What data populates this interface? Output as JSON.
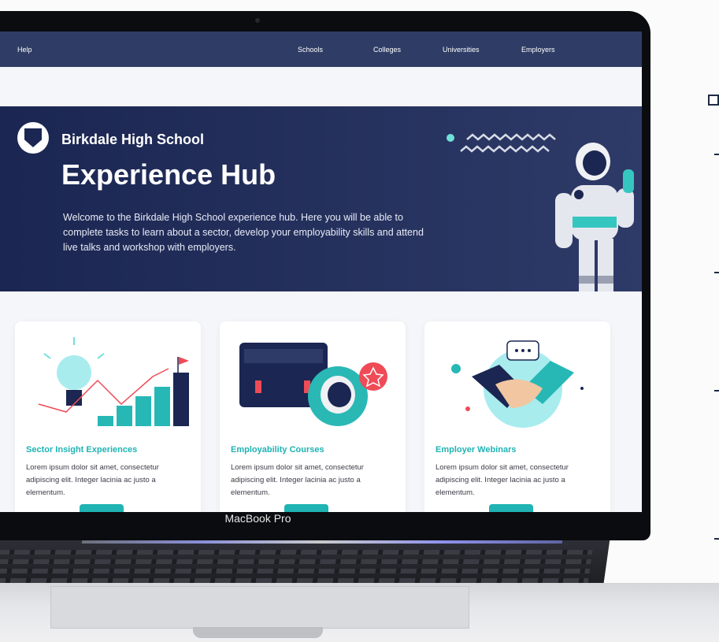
{
  "nav": {
    "help": "Help",
    "links": [
      "Schools",
      "Colleges",
      "Universities",
      "Employers"
    ]
  },
  "hero": {
    "school_name": "Birkdale High School",
    "title": "Experience Hub",
    "intro": "Welcome to the Birkdale High School experience hub. Here you will be able to complete tasks to learn about a sector, develop your employability skills and attend live talks and workshop with employers."
  },
  "cards": [
    {
      "title": "Sector Insight Experiences",
      "description": "Lorem ipsum dolor sit amet, consectetur adipiscing elit. Integer lacinia ac justo a elementum.",
      "icon": "lightbulb-growth-chart-icon"
    },
    {
      "title": "Employability Courses",
      "description": "Lorem ipsum dolor sit amet, consectetur adipiscing elit. Integer lacinia ac justo a elementum.",
      "icon": "briefcase-astronaut-icon"
    },
    {
      "title": "Employer  Webinars",
      "description": "Lorem ipsum dolor sit amet, consectetur adipiscing elit. Integer lacinia ac justo a elementum.",
      "icon": "handshake-icon"
    }
  ],
  "device": {
    "label": "MacBook Pro"
  },
  "colors": {
    "nav": "#2f3d66",
    "hero": "#1b2652",
    "accent": "#1fb3b3",
    "coral": "#ef4b57"
  }
}
